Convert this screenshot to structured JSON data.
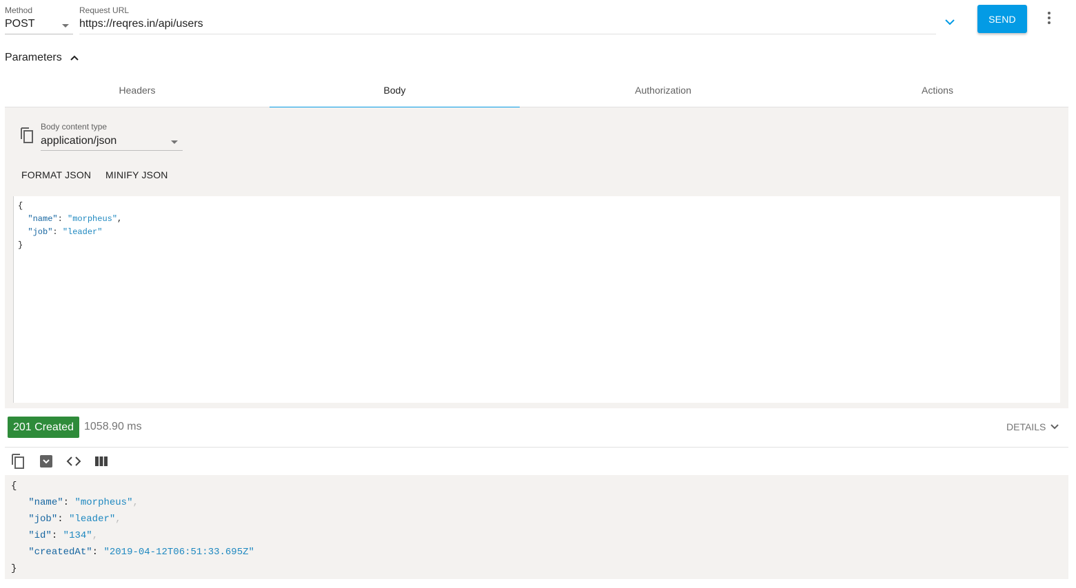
{
  "request": {
    "method_label": "Method",
    "method_value": "POST",
    "url_label": "Request URL",
    "url_value": "https://reqres.in/api/users",
    "send_label": "SEND"
  },
  "parameters": {
    "label": "Parameters"
  },
  "tabs": [
    {
      "label": "Headers"
    },
    {
      "label": "Body"
    },
    {
      "label": "Authorization"
    },
    {
      "label": "Actions"
    }
  ],
  "active_tab": "Body",
  "body": {
    "content_type_label": "Body content type",
    "content_type_value": "application/json",
    "format_label": "FORMAT JSON",
    "minify_label": "MINIFY JSON",
    "editor": {
      "open": "{",
      "close": "}",
      "fields": [
        {
          "key": "name",
          "value": "morpheus"
        },
        {
          "key": "job",
          "value": "leader"
        }
      ]
    }
  },
  "response": {
    "status": "201 Created",
    "timing": "1058.90 ms",
    "details_label": "DETAILS",
    "json": {
      "open": "{",
      "close": "}",
      "fields": [
        {
          "key": "name",
          "value": "morpheus"
        },
        {
          "key": "job",
          "value": "leader"
        },
        {
          "key": "id",
          "value": "134"
        },
        {
          "key": "createdAt",
          "value": "2019-04-12T06:51:33.695Z"
        }
      ]
    }
  },
  "icons": {
    "method_dropdown": "caret-down-icon",
    "url_history": "chevron-down-icon",
    "menu": "more-vert-icon",
    "params_toggle": "chevron-up-icon",
    "content_type": "copy-icon",
    "resp_copy": "copy-icon",
    "resp_save": "save-icon",
    "resp_raw": "code-icon",
    "resp_columns": "columns-icon"
  },
  "colors": {
    "accent": "#039be5",
    "status_success": "#2e8b3a",
    "panel_bg": "#f4f2f0",
    "json_key": "#1565a0",
    "json_string": "#1e88c0"
  }
}
